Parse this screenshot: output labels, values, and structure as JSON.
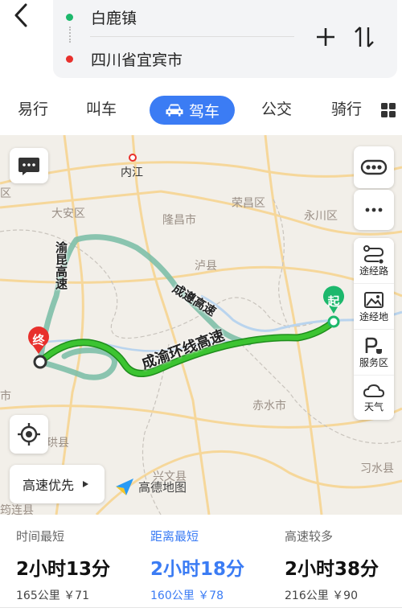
{
  "header": {
    "origin": "白鹿镇",
    "destination": "四川省宜宾市",
    "colors": {
      "origin_dot": "#1db86c",
      "destination_dot": "#e8302c"
    }
  },
  "tabs": [
    {
      "label": "易行"
    },
    {
      "label": "叫车"
    },
    {
      "label": "驾车",
      "active": true
    },
    {
      "label": "公交"
    },
    {
      "label": "骑行"
    }
  ],
  "map": {
    "cities": [
      {
        "name": "内江"
      },
      {
        "name": "大安区"
      },
      {
        "name": "隆昌市"
      },
      {
        "name": "荣昌区"
      },
      {
        "name": "永川区"
      },
      {
        "name": "泸县"
      },
      {
        "name": "赤水市"
      },
      {
        "name": "兴文县"
      },
      {
        "name": "习水县"
      },
      {
        "name": "珙县"
      },
      {
        "name": "区"
      },
      {
        "name": "市"
      },
      {
        "name": "筠连县"
      }
    ],
    "highways": [
      {
        "name": "渝昆高速"
      },
      {
        "name": "成遵高速"
      },
      {
        "name": "成渝环线高速"
      }
    ],
    "start_label": "起",
    "end_label": "终",
    "right_panel": [
      {
        "label": "",
        "icon": "traffic-icon"
      },
      {
        "label": "",
        "icon": "more-icon"
      },
      {
        "label": "途经路",
        "icon": "waypoint-road-icon"
      },
      {
        "label": "途经地",
        "icon": "waypoint-place-icon"
      },
      {
        "label": "服务区",
        "icon": "service-area-icon"
      },
      {
        "label": "天气",
        "icon": "weather-icon"
      }
    ],
    "preference": "高速优先",
    "logo_text": "高德地图",
    "colors": {
      "main_route": "#21a81f",
      "alt_route": "#8fcfb8",
      "accent": "#3b7cf4"
    }
  },
  "routes": [
    {
      "tag": "时间最短",
      "time": "2小时13分",
      "meta": "165公里 ￥71",
      "selected": false
    },
    {
      "tag": "距离最短",
      "time": "2小时18分",
      "meta": "160公里 ￥78",
      "selected": true
    },
    {
      "tag": "高速较多",
      "time": "2小时38分",
      "meta": "216公里 ￥90",
      "selected": false
    }
  ]
}
